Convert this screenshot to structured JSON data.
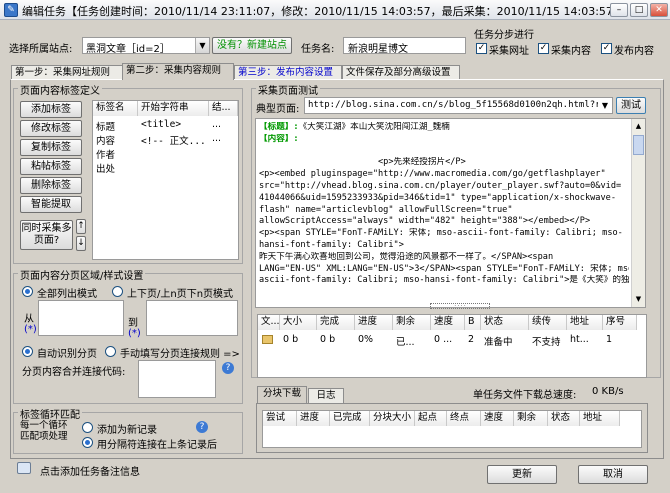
{
  "window": {
    "title": "编辑任务【任务创建时间：2010/11/14 23:11:07，修改：2010/11/15 14:03:57，最后采集：2010/11/15 14:03:57】",
    "minimize": "–",
    "maximize": "□",
    "close": "✕"
  },
  "top": {
    "site_label": "选择所属站点:",
    "site_value": "黑洞文章［id=2］",
    "new_site_link": "没有？新建站点",
    "task_name_label": "任务名:",
    "task_name_value": "新浪明星博文",
    "progress_title": "任务分步进行",
    "opt_collect_url": "采集网址",
    "opt_collect_content": "采集内容",
    "opt_publish_content": "发布内容"
  },
  "tabs": [
    "第一步：采集网址规则",
    "第二步：采集内容规则",
    "第三步：发布内容设置",
    "文件保存及部分高级设置"
  ],
  "tag_panel": {
    "title": "页面内容标签定义",
    "buttons": [
      "添加标签",
      "修改标签",
      "复制标签",
      "粘帖标签",
      "删除标签",
      "智能提取"
    ],
    "sync_button": "同时采集多页面?",
    "columns": [
      "标签名",
      "开始字符串",
      "结..."
    ],
    "rows": [
      {
        "name": "标题",
        "start": "<title>",
        "end": "..."
      },
      {
        "name": "内容",
        "start": "<!-- 正文...",
        "end": "..."
      },
      {
        "name": "作者",
        "start": "",
        "end": ""
      },
      {
        "name": "出处",
        "start": "",
        "end": ""
      }
    ]
  },
  "paging": {
    "title": "页面内容分页区域/样式设置",
    "mode_all": "全部列出模式",
    "mode_prevnext": "上下页/上n页下n页模式",
    "from_label": "从",
    "to_label": "到",
    "marker": "(*)",
    "auto_identify": "自动识别分页",
    "manual_rule": "手动填写分页连接规则 =>",
    "merge_code_label": "分页内容合并连接代码:",
    "help": "?"
  },
  "loop": {
    "title": "标签循环匹配",
    "each_loop_label": "每一个循环匹配项处理",
    "opt_new_record": "添加为新记录",
    "opt_join_prev": "用分隔符连接在上条记录后"
  },
  "test": {
    "title": "采集页面测试",
    "typical_label": "典型页面:",
    "url": "http://blog.sina.com.cn/s/blog_5f15568d0100n2qh.html?retc",
    "test_button": "测试",
    "result_lines": [
      {
        "t": "【标题】:",
        "v": "《大笑江湖》本山大笑沈阳闯江湖_魏楠",
        "cls": "title"
      },
      {
        "t": "【内容】:",
        "v": "",
        "cls": "title"
      },
      {
        "t": "",
        "v": "",
        "cls": ""
      },
      {
        "t": "",
        "v": "                       <p>先来经授拐片</P>",
        "cls": ""
      },
      {
        "t": "",
        "v": "<p><embed pluginspage=\"http://www.macromedia.com/go/getflashplayer\"",
        "cls": ""
      },
      {
        "t": "",
        "v": "src=\"http://vhead.blog.sina.com.cn/player/outer_player.swf?auto=0&vid=",
        "cls": ""
      },
      {
        "t": "",
        "v": "41044066&uid=1595233933&pid=346&tid=1\" type=\"application/x-shockwave-",
        "cls": ""
      },
      {
        "t": "",
        "v": "flash\" name=\"articlevblog\" allowFullScreen=\"true\"",
        "cls": ""
      },
      {
        "t": "",
        "v": "allowScriptAccess=\"always\" width=\"482\" height=\"388\"></embed></P>",
        "cls": ""
      },
      {
        "t": "",
        "v": "<p><span STYLE=\"FonT-FAMiLY: 宋体; mso-ascii-font-family: Calibri; mso-",
        "cls": ""
      },
      {
        "t": "",
        "v": "hansi-font-family: Calibri\">",
        "cls": ""
      },
      {
        "t": "",
        "v": "昨天下午满心欢喜地回到公司，觉得沿途的风景都不一样了。</SPAN><span",
        "cls": ""
      },
      {
        "t": "",
        "v": "LANG=\"EN-US\" XML:LANG=\"EN-US\">3</SPAN><span STYLE=\"FonT-FAMiLY: 宋体; mso-",
        "cls": ""
      },
      {
        "t": "",
        "v": "ascii-font-family: Calibri; mso-hansi-font-family: Calibri\">是《大笑》的独",
        "cls": ""
      }
    ]
  },
  "download_list": {
    "columns": [
      "文...",
      "大小",
      "完成",
      "进度",
      "剩余",
      "速度",
      "B",
      "状态",
      "续传",
      "地址",
      "序号"
    ],
    "rows": [
      {
        "c": [
          "",
          "0 b",
          "0 b",
          "0%",
          "已...",
          "0 ...",
          "2",
          "准备中",
          "不支持",
          "ht...",
          "1"
        ]
      }
    ]
  },
  "bottom_tabs": {
    "tabs": [
      "分块下载",
      "日志"
    ],
    "speed_label": "单任务文件下载总速度:",
    "speed_value": "0 KB/s",
    "columns": [
      "尝试",
      "进度",
      "已完成",
      "分块大小",
      "起点",
      "终点",
      "速度",
      "剩余",
      "状态",
      "地址"
    ]
  },
  "footer": {
    "note": "点击添加任务备注信息",
    "update": "更新",
    "cancel": "取消"
  }
}
